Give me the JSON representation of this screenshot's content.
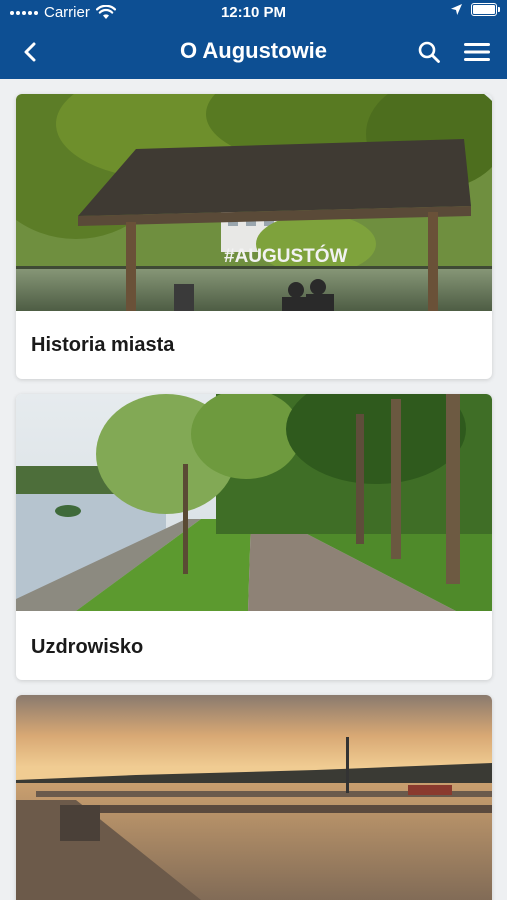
{
  "status": {
    "carrier": "Carrier",
    "time": "12:10 PM",
    "wifi_icon": "wifi-icon",
    "location_icon": "location-arrow-icon",
    "battery_icon": "battery-icon"
  },
  "header": {
    "title": "O Augustowie",
    "back_icon": "chevron-left-icon",
    "search_icon": "search-icon",
    "menu_icon": "hamburger-menu-icon",
    "background": "#0d4f93"
  },
  "cards": [
    {
      "title": "Historia miasta",
      "sign_text": "#AUGUSTÓW"
    },
    {
      "title": "Uzdrowisko"
    },
    {
      "title": ""
    }
  ]
}
